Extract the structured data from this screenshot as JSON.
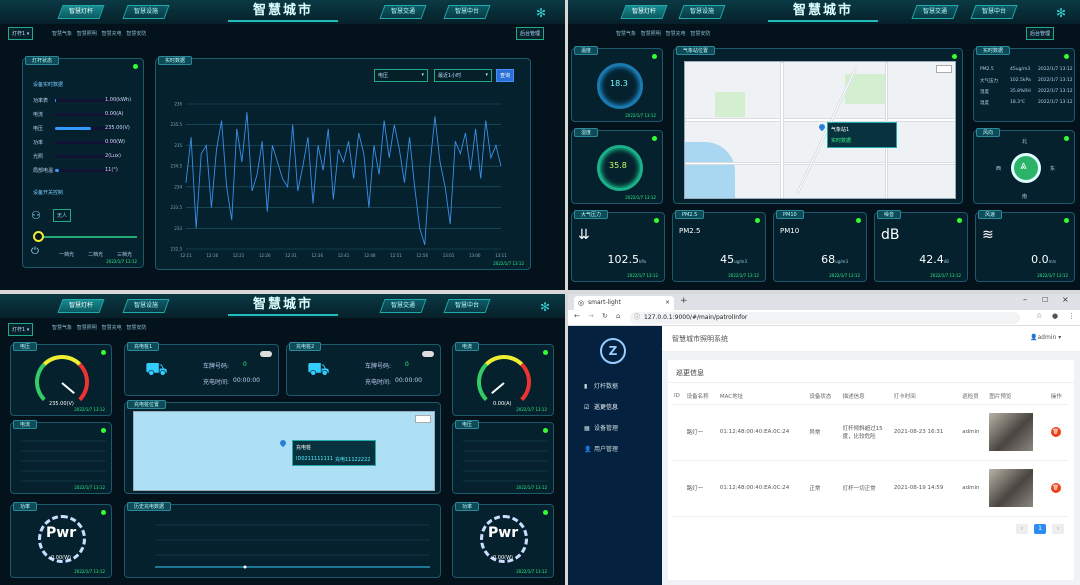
{
  "common": {
    "title": "智慧城市",
    "nav": [
      "智慧灯杆",
      "智慧设施",
      "智慧交通",
      "智慧中台"
    ],
    "crumbs": [
      "智慧气象",
      "智慧照明",
      "智慧充电",
      "智慧安防"
    ],
    "pole_select": "灯杆1",
    "back": "后台管理"
  },
  "q1": {
    "status_title": "灯杆状态",
    "dev_title": "设备实时数据",
    "rows": [
      {
        "label": "功率表",
        "value": "1.00(kWh)",
        "fill": 0.02
      },
      {
        "label": "电流",
        "value": "0.00(A)",
        "fill": 0
      },
      {
        "label": "电压",
        "value": "235.00(V)",
        "fill": 0.6
      },
      {
        "label": "功率",
        "value": "0.00(W)",
        "fill": 0
      },
      {
        "label": "光照",
        "value": "2(Lux)",
        "fill": 0
      },
      {
        "label": "局部电温",
        "value": "11(°)",
        "fill": 0.06
      }
    ],
    "pir_title": "设备开关控制",
    "pir_value": "无人",
    "modes": [
      "一档光",
      "二档光",
      "三档光"
    ],
    "ts": "2022/1/7 13:12",
    "chart_title": "实时数据",
    "sel_a": "电压",
    "sel_b": "最近1小时",
    "query": "查询",
    "chart_data": {
      "type": "line",
      "ylabels": [
        "236",
        "235.5",
        "235",
        "234.5",
        "234",
        "233.5",
        "233",
        "232.5"
      ],
      "xlabels": [
        "12:11",
        "12:16",
        "12:21",
        "12:26",
        "12:31",
        "12:36",
        "12:41",
        "12:46",
        "12:51",
        "12:56",
        "13:01",
        "13:06",
        "13:11"
      ],
      "ylim": [
        232.5,
        236
      ],
      "values": [
        234.1,
        235.2,
        233.0,
        234.8,
        235.0,
        233.5,
        234.9,
        235.6,
        234.0,
        233.2,
        235.4,
        234.6,
        235.8,
        233.9,
        234.3,
        235.1,
        233.4,
        235.0,
        234.6,
        234.2,
        234.0,
        235.5,
        233.9,
        234.5,
        235.2,
        233.6,
        235.0,
        234.4,
        235.4,
        233.7,
        234.9,
        234.6,
        235.1,
        234.2,
        235.3,
        234.8,
        233.5,
        235.0,
        234.3,
        235.6,
        234.7,
        235.5,
        234.9,
        234.1,
        235.2,
        234.0,
        233.0,
        232.6,
        234.5,
        235.7,
        234.6,
        234.0,
        233.1,
        235.1,
        234.8,
        235.3,
        234.4,
        235.4,
        234.2,
        235.6,
        234.7,
        235.0,
        234.5
      ]
    }
  },
  "q2": {
    "temp_title": "温度",
    "temp": "18.3",
    "hum_title": "湿度",
    "hum": "35.8",
    "map_title": "气象站位置",
    "rt_title": "实时数据",
    "rt_rows": [
      {
        "k": "PM2.5",
        "v": "45ug/m3",
        "t": "2022/1/7 13:12"
      },
      {
        "k": "大气压力",
        "v": "102.5kPa",
        "t": "2022/1/7 13:12"
      },
      {
        "k": "湿度",
        "v": "35.8%RH",
        "t": "2022/1/7 13:12"
      },
      {
        "k": "温度",
        "v": "18.3℃",
        "t": "2022/1/7 13:12"
      }
    ],
    "wind_title": "风向",
    "north": "北",
    "south": "南",
    "west": "西",
    "east": "东",
    "cards": [
      {
        "title": "大气压力",
        "value": "102.5",
        "unit": "kPa",
        "icon": "pressure-icon",
        "glyph": "⇊"
      },
      {
        "title": "PM2.5",
        "value": "45",
        "unit": "ug/m3",
        "icon": "pm25-icon",
        "glyph": "PM2.5"
      },
      {
        "title": "PM10",
        "value": "68",
        "unit": "ug/m3",
        "icon": "pm10-icon",
        "glyph": "PM10"
      },
      {
        "title": "噪音",
        "value": "42.4",
        "unit": "dB",
        "icon": "noise-icon",
        "glyph": "dB"
      },
      {
        "title": "风速",
        "value": "0.0",
        "unit": "m/s",
        "icon": "wind-icon",
        "glyph": "≋"
      }
    ],
    "map_popup": "气象站1",
    "map_popup_sub": "实时数据",
    "ts": "2022/1/7 13:12"
  },
  "q3": {
    "left_gauge_title": "电压",
    "left_gauge_val": "235.00(V)",
    "right_gauge_title": "电流",
    "right_gauge_val": "0.00(A)",
    "chg1_title": "充电桩1",
    "chg2_title": "充电桩2",
    "plate_label": "车牌号码:",
    "plate": "0",
    "time_label": "充电时间:",
    "time": "00:00:00",
    "map_title": "充电桩位置",
    "popup": "充电桩",
    "popup_id": "ID0211111111",
    "popup_sub": "充电11122222",
    "power_title_l": "功率",
    "power_title_r": "功率",
    "power_val": "0.00(W)",
    "mid_title": "历史充电数据",
    "small_l": "电流",
    "small_r": "电压",
    "ts": "2022/1/7 13:12"
  },
  "q4": {
    "tab_title": "smart-light",
    "url": "127.0.0.1:9000/#/main/patrolInfor",
    "app_title": "智慧城市照明系统",
    "user": "admin",
    "menu": [
      "灯杆数据",
      "巡更信息",
      "设备管理",
      "用户管理"
    ],
    "section": "巡更信息",
    "headers": [
      "ID",
      "设备名称",
      "MAC地址",
      "设备状态",
      "描述信息",
      "打卡时间",
      "巡检员",
      "图片预览",
      "操作"
    ],
    "rows": [
      {
        "name": "路灯一",
        "mac": "01:12:48:00:40:EA:0C:24",
        "status": "异常",
        "desc": "灯杆倾斜超过15度，比较危险",
        "time": "2021-08-23 16:31",
        "inspector": "admin"
      },
      {
        "name": "路灯一",
        "mac": "01:12:48:00:40:EA:0C:24",
        "status": "正常",
        "desc": "灯杆一切正常",
        "time": "2021-08-19 14:59",
        "inspector": "admin"
      }
    ],
    "page": "1"
  }
}
